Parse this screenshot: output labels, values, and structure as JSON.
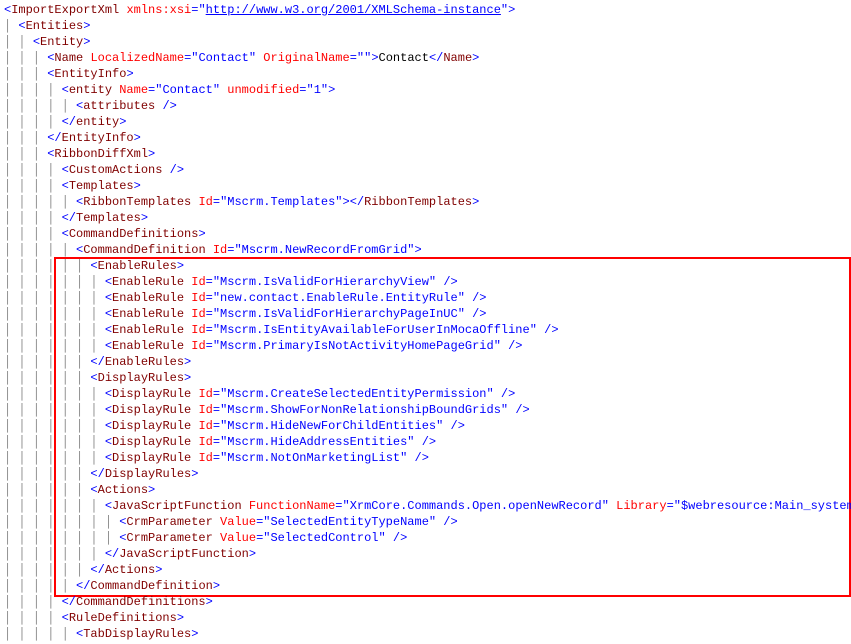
{
  "xmlns_url": "http://www.w3.org/2001/XMLSchema-instance",
  "name": {
    "localized": "Contact",
    "original": "",
    "text": "Contact"
  },
  "entity": {
    "name": "Contact",
    "unmodified": "1"
  },
  "ribbonTemplatesId": "Mscrm.Templates",
  "cmdDefId": "Mscrm.NewRecordFromGrid",
  "enableRules": [
    "Mscrm.IsValidForHierarchyView",
    "new.contact.EnableRule.EntityRule",
    "Mscrm.IsValidForHierarchyPageInUC",
    "Mscrm.IsEntityAvailableForUserInMocaOffline",
    "Mscrm.PrimaryIsNotActivityHomePageGrid"
  ],
  "displayRules": [
    "Mscrm.CreateSelectedEntityPermission",
    "Mscrm.ShowForNonRelationshipBoundGrids",
    "Mscrm.HideNewForChildEntities",
    "Mscrm.HideAddressEntities",
    "Mscrm.NotOnMarketingList"
  ],
  "jsFunc": {
    "name": "XrmCore.Commands.Open.openNewRecord",
    "library": "$webresource:Main_system_library.js"
  },
  "crmParams": [
    "SelectedEntityTypeName",
    "SelectedControl"
  ],
  "guides": {
    "g0": " ",
    "g1": " │ ",
    "g2": " │ │ ",
    "g3": " │ │ │ ",
    "g4": " │ │ │ │ ",
    "g5": " │ │ │ │ │ ",
    "g6": " │ │ │ │ │ │ ",
    "g7": " │ │ │ │ │ │ │ ",
    "g8": " │ │ │ │ │ │ │ │ "
  }
}
